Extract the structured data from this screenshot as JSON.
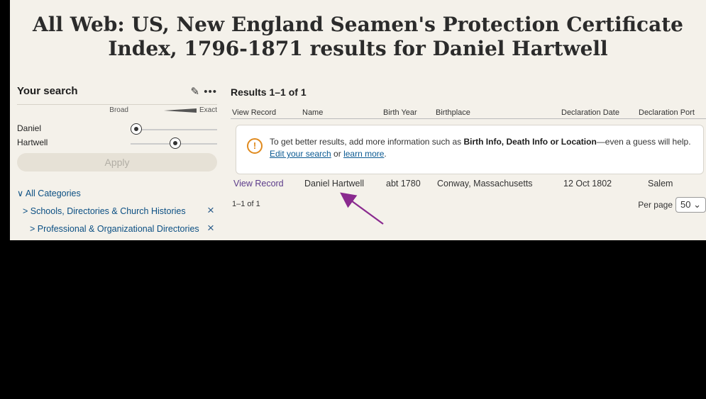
{
  "header": {
    "title_line1": "All Web: US, New England Seamen's Protection Certificate",
    "title_line2": "Index, 1796-1871 results for Daniel Hartwell"
  },
  "sidebar": {
    "title": "Your search",
    "actions": "✎ •••",
    "scale_broad": "Broad",
    "scale_exact": "Exact",
    "terms": [
      {
        "label": "Daniel",
        "level": 0.0
      },
      {
        "label": "Hartwell",
        "level": 0.45
      }
    ],
    "apply_label": "Apply",
    "categories": [
      {
        "label": "∨ All Categories",
        "removable": false
      },
      {
        "label": "> Schools, Directories & Church Histories",
        "removable": true
      },
      {
        "label": "> Professional & Organizational Directories",
        "removable": true
      }
    ],
    "remove_icon": "×"
  },
  "results": {
    "title": "Results 1–1 of 1",
    "columns": [
      "View Record",
      "Name",
      "Birth Year",
      "Birthplace",
      "Declaration Date",
      "Declaration Port"
    ],
    "alert": {
      "text_start": "To get better results, add more information such as ",
      "text_bold": "Birth Info, Death Info or Location",
      "text_mid": "—even a guess will help. ",
      "link1": "Edit your search",
      "text_or": " or ",
      "link2": "learn more",
      "text_end": "."
    },
    "rows": [
      [
        "View Record",
        "Daniel Hartwell",
        "abt 1780",
        "Conway, Massachusetts",
        "12 Oct 1802",
        "Salem"
      ]
    ],
    "count_text": "1–1 of 1",
    "per_page_label": "Per page",
    "per_page_value": "50",
    "per_page_icon": "chevron-down-icon"
  },
  "colors": {
    "link": "#0b4f83",
    "view_record": "#5b3b8a",
    "arrow": "#8a2a8f",
    "alert_icon": "#e08a1e"
  }
}
